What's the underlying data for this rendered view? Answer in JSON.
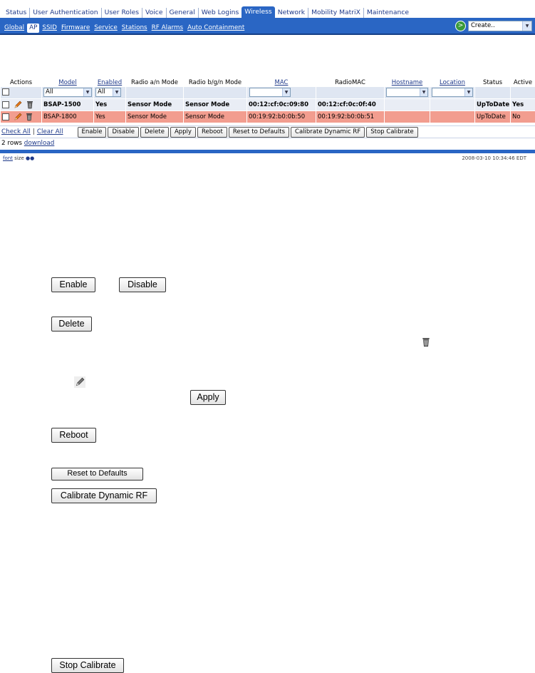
{
  "top_nav": [
    "Status",
    "User Authentication",
    "User Roles",
    "Voice",
    "General",
    "Web Logins",
    "Wireless",
    "Network",
    "Mobility MatriX",
    "Maintenance"
  ],
  "top_nav_active": "Wireless",
  "sub_nav": [
    "Global",
    "AP",
    "SSID",
    "Firmware",
    "Service",
    "Stations",
    "RF Alarms",
    "Auto Containment"
  ],
  "sub_nav_active": "AP",
  "create_select": {
    "value": "Create..",
    "go_icon": ">"
  },
  "table": {
    "columns": [
      "Actions",
      "Model",
      "Enabled",
      "Radio a/n Mode",
      "Radio b/g/n Mode",
      "MAC",
      "RadioMAC",
      "Hostname",
      "Location",
      "Status",
      "Active"
    ],
    "filters": {
      "model": "All",
      "enabled": "All",
      "mac": "",
      "hostname": "",
      "location": ""
    },
    "rows": [
      {
        "model": "BSAP-1500",
        "enabled": "Yes",
        "radio_an": "Sensor Mode",
        "radio_bgn": "Sensor Mode",
        "mac": "00:12:cf:0c:09:80",
        "radio_mac": "00:12:cf:0c:0f:40",
        "hostname": "",
        "location": "",
        "status": "UpToDate",
        "active": "Yes"
      },
      {
        "model": "BSAP-1800",
        "enabled": "Yes",
        "radio_an": "Sensor Mode",
        "radio_bgn": "Sensor Mode",
        "mac": "00:19:92:b0:0b:50",
        "radio_mac": "00:19:92:b0:0b:51",
        "hostname": "",
        "location": "",
        "status": "UpToDate",
        "active": "No"
      }
    ]
  },
  "action_bar": {
    "check_all": "Check All",
    "separator": "|",
    "clear_all": "Clear All",
    "buttons": [
      "Enable",
      "Disable",
      "Delete",
      "Apply",
      "Reboot",
      "Reset to Defaults",
      "Calibrate Dynamic RF",
      "Stop Calibrate"
    ]
  },
  "row_info": {
    "count": "2 rows",
    "download": "download"
  },
  "footer": {
    "font_link": "font",
    "size_label": "size",
    "timestamp": "2008-03-10 10:34:46 EDT"
  },
  "legend": {
    "enable": "Enable",
    "disable": "Disable",
    "delete": "Delete",
    "apply": "Apply",
    "reboot": "Reboot",
    "reset": "Reset to Defaults",
    "calibrate": "Calibrate Dynamic RF",
    "stop": "Stop Calibrate",
    "icons": [
      "trash-icon",
      "pencil-icon"
    ]
  },
  "colors": {
    "nav_blue": "#2a66c4",
    "row_highlight": "#f29d8f",
    "row_normal": "#e9edf5"
  }
}
